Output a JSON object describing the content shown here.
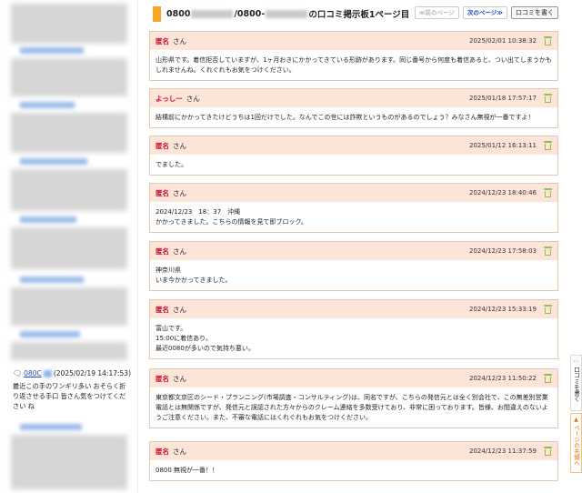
{
  "header": {
    "title_prefix": "0800",
    "title_middle": "/0800-",
    "title_suffix": "の口コミ掲示板1ページ目",
    "prev_label": "≪前のページ",
    "next_label": "次のページ≫",
    "write_label": "口コミを書く"
  },
  "colors": {
    "accent": "#f5a623",
    "post_header_bg": "#fde4d8",
    "name_red": "#c8102e",
    "link_blue": "#2246c8"
  },
  "sidebar": {
    "post": {
      "number": "080C",
      "date": "(2025/02/19 14:17:53)",
      "body": "最近この手のワンギリ多い おそらく折り返させる手口 皆さん気をつけてください ね",
      "icon": "comment-icon"
    }
  },
  "posts": [
    {
      "name": "匿名",
      "san": "さん",
      "date": "2025/02/01 10:38:32",
      "body": "山形県です。着信拒否していますが、1ヶ月おきにかかってきている形跡があります。同じ番号から何度も着信あると、つい出てしまうかもしれませんね。くれぐれもお気をつけください。"
    },
    {
      "name": "よっしー",
      "san": "さん",
      "date": "2025/01/18 17:57:17",
      "body": "結構前にかかってきたけどうちは1回だけでした。なんでこの世には詐欺というものがあるのでしょう？みなさん無視が一番ですよ！"
    },
    {
      "name": "匿名",
      "san": "さん",
      "date": "2025/01/12 16:13:11",
      "body": "でました。"
    },
    {
      "name": "匿名",
      "san": "さん",
      "date": "2024/12/23 18:40:46",
      "body": "2024/12/23　18：37　沖縄\nかかってきました。こちらの情報を見て即ブロック。"
    },
    {
      "name": "匿名",
      "san": "さん",
      "date": "2024/12/23 17:58:03",
      "body": "神奈川県\nいま今かかってきました。"
    },
    {
      "name": "匿名",
      "san": "さん",
      "date": "2024/12/23 15:33:19",
      "body": "富山です。\n15:00に着信あり。\n最近0080が多いので気持ち悪い。"
    },
    {
      "name": "匿名",
      "san": "さん",
      "date": "2024/12/23 11:50:22",
      "body": "東京都文京区のシード・プランニング(市場調査・コンサルティング)は、同名ですが、こちらの発信元とは全く別会社で、この無差別営業電話とは無関係ですが、発信元と誤認された方々からのクレーム連絡を多数受けており、非常に困っております。皆様、お間違えのないようご注意ください。また、不審な電話にはくれぐれもお気をつけください。"
    },
    {
      "name": "匿名",
      "san": "さん",
      "date": "2024/12/23 11:37:59",
      "body": "0800 無視が一番！！"
    }
  ],
  "float_tabs": {
    "write_label": "口コミを書く",
    "top_label": "ページの先頭へ"
  }
}
